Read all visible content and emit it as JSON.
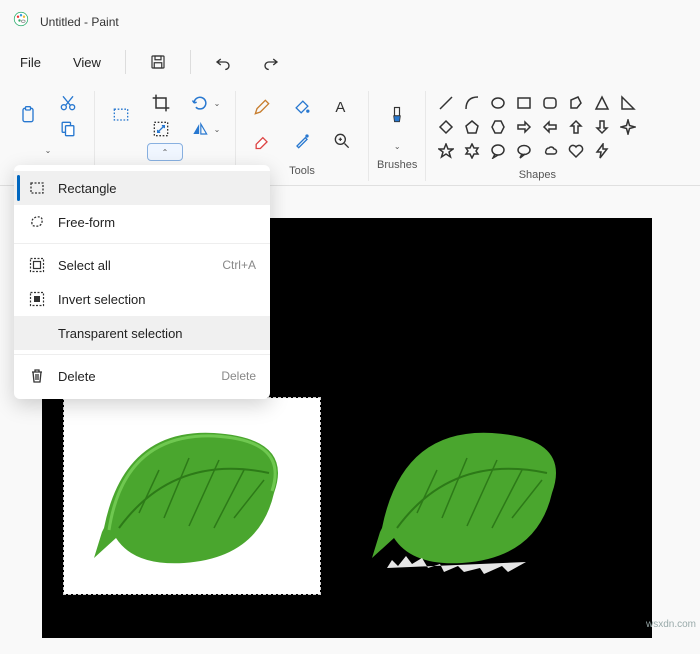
{
  "titlebar": {
    "title": "Untitled - Paint"
  },
  "menubar": {
    "file": "File",
    "view": "View"
  },
  "ribbon": {
    "tools_label": "Tools",
    "brushes_label": "Brushes",
    "shapes_label": "Shapes"
  },
  "dropdown": {
    "rectangle": "Rectangle",
    "freeform": "Free-form",
    "select_all": "Select all",
    "select_all_accel": "Ctrl+A",
    "invert": "Invert selection",
    "transparent": "Transparent selection",
    "delete": "Delete",
    "delete_accel": "Delete"
  },
  "watermark": "wsxdn.com"
}
